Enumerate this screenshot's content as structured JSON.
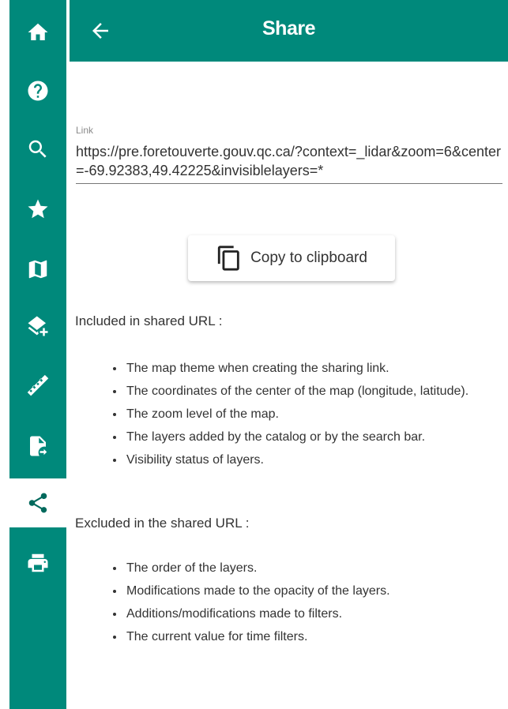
{
  "sidebar": {
    "items": [
      {
        "name": "home",
        "icon": "home-icon",
        "active": false
      },
      {
        "name": "help",
        "icon": "help-icon",
        "active": false
      },
      {
        "name": "search",
        "icon": "search-icon",
        "active": false
      },
      {
        "name": "favorites",
        "icon": "star-icon",
        "active": false
      },
      {
        "name": "map",
        "icon": "map-icon",
        "active": false
      },
      {
        "name": "layers",
        "icon": "layers-plus-icon",
        "active": false
      },
      {
        "name": "measure",
        "icon": "ruler-icon",
        "active": false
      },
      {
        "name": "import",
        "icon": "file-import-icon",
        "active": false
      },
      {
        "name": "share",
        "icon": "share-icon",
        "active": true
      },
      {
        "name": "print",
        "icon": "printer-icon",
        "active": false
      }
    ]
  },
  "header": {
    "title": "Share",
    "back_icon": "arrow-left-icon"
  },
  "link": {
    "label": "Link",
    "value": "https://pre.foretouverte.gouv.qc.ca/?context=_lidar&zoom=6&center=-69.92383,49.42225&invisiblelayers=*"
  },
  "copy_button": {
    "label": "Copy to clipboard",
    "icon": "copy-icon"
  },
  "included": {
    "title": "Included in shared URL :",
    "items": [
      "The map theme when creating the sharing link.",
      "The coordinates of the center of the map (longitude, latitude).",
      "The zoom level of the map.",
      "The layers added by the catalog or by the search bar.",
      "Visibility status of layers."
    ]
  },
  "excluded": {
    "title": "Excluded in the shared URL :",
    "items": [
      "The order of the layers.",
      "Modifications made to the opacity of the layers.",
      "Additions/modifications made to filters.",
      "The current value for time filters."
    ]
  },
  "colors": {
    "primary": "#00897b",
    "active_icon": "#00695c"
  }
}
